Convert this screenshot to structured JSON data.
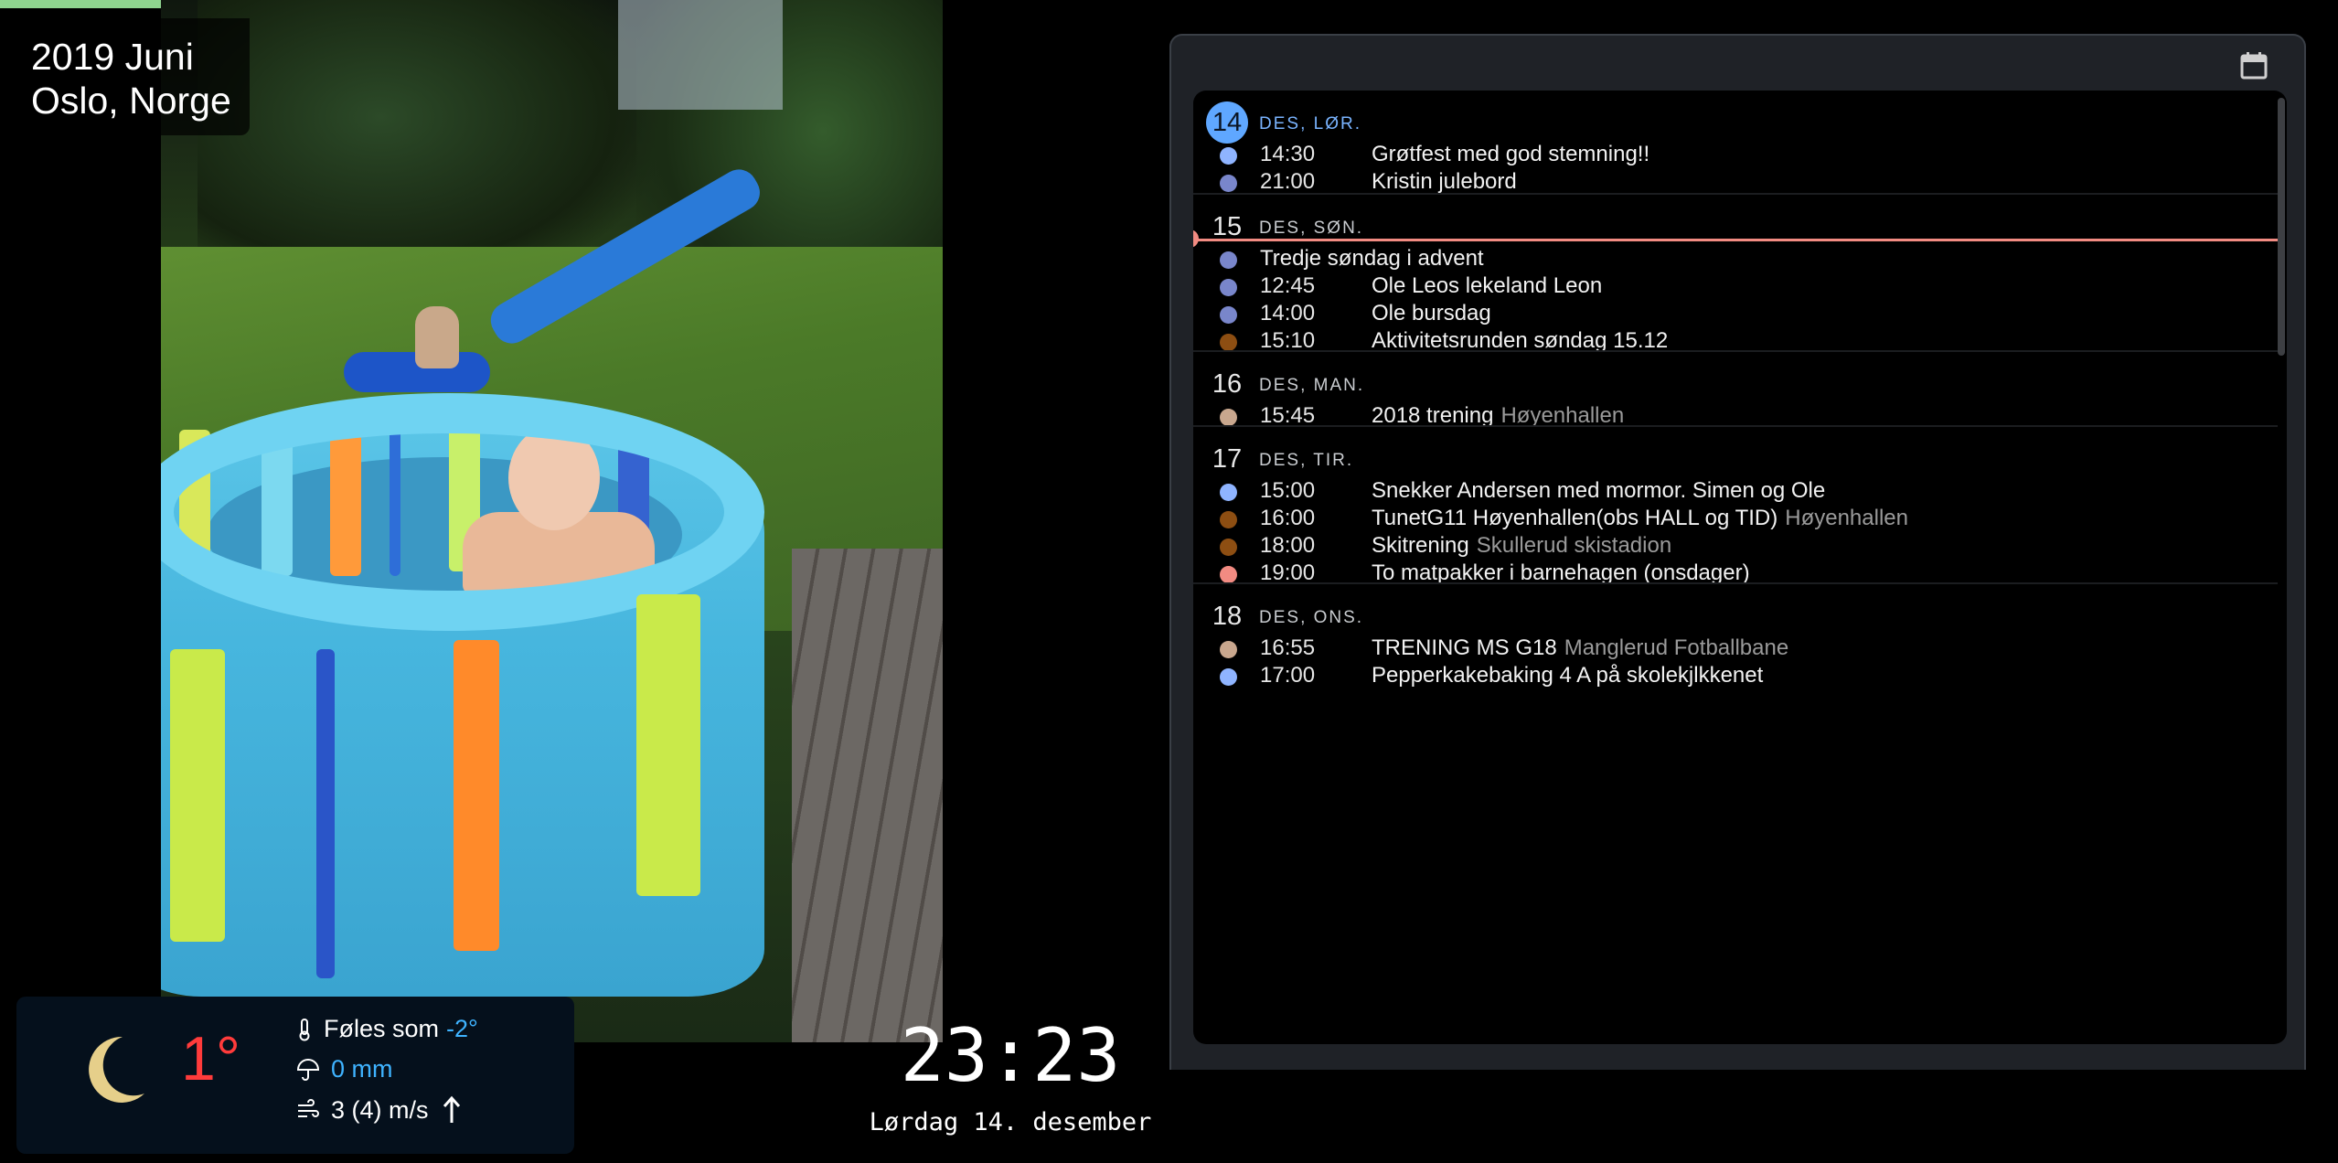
{
  "progress": {
    "fraction": 0.255,
    "color": "#8fd48f"
  },
  "photo": {
    "alt_semantic": "slideshow-photo"
  },
  "location": {
    "line1": "2019 Juni",
    "line2": "Oslo, Norge"
  },
  "weather": {
    "icon": "moon-icon",
    "temperature": "1°",
    "feels_like_label": "Føles som",
    "feels_like_value": "-2°",
    "precipitation": "0 mm",
    "wind": "3 (4) m/s",
    "wind_direction_icon": "arrow-up-icon"
  },
  "clock": {
    "time": "23:23",
    "date": "Lørdag 14. desember"
  },
  "calendar": {
    "header_icon": "calendar-icon",
    "days": [
      {
        "num": "14",
        "label": "DES, LØR.",
        "today": true,
        "events": [
          {
            "time": "14:30",
            "title": "Grøtfest med god stemning!!",
            "location": "",
            "color": "#8fb4ff"
          },
          {
            "time": "21:00",
            "title": "Kristin julebord",
            "location": "",
            "color": "#7986cb"
          }
        ]
      },
      {
        "num": "15",
        "label": "DES, SØN.",
        "today": false,
        "events": [
          {
            "time": "",
            "title": "Tredje søndag i advent",
            "location": "",
            "color": "#7986cb"
          },
          {
            "time": "12:45",
            "title": "Ole Leos lekeland Leon",
            "location": "",
            "color": "#7986cb"
          },
          {
            "time": "14:00",
            "title": "Ole bursdag",
            "location": "",
            "color": "#7986cb"
          },
          {
            "time": "15:10",
            "title": "Aktivitetsrunden søndag 15.12",
            "location": "",
            "color": "#8d4e12"
          }
        ]
      },
      {
        "num": "16",
        "label": "DES, MAN.",
        "today": false,
        "events": [
          {
            "time": "15:45",
            "title": "2018 trening",
            "location": "Høyenhallen",
            "color": "#c9a78e"
          }
        ]
      },
      {
        "num": "17",
        "label": "DES, TIR.",
        "today": false,
        "events": [
          {
            "time": "15:00",
            "title": "Snekker Andersen med mormor. Simen og Ole",
            "location": "",
            "color": "#8fb4ff"
          },
          {
            "time": "16:00",
            "title": "TunetG11 Høyenhallen(obs HALL og TID)",
            "location": "Høyenhallen",
            "color": "#8d4e12"
          },
          {
            "time": "18:00",
            "title": "Skitrening",
            "location": "Skullerud skistadion",
            "color": "#8d4e12"
          },
          {
            "time": "19:00",
            "title": "To matpakker i barnehagen (onsdager)",
            "location": "",
            "color": "#f28b82"
          }
        ]
      },
      {
        "num": "18",
        "label": "DES, ONS.",
        "today": false,
        "events": [
          {
            "time": "16:55",
            "title": "TRENING MS G18",
            "location": "Manglerud Fotballbane",
            "color": "#c9a78e"
          },
          {
            "time": "17:00",
            "title": "Pepperkakebaking 4 A på skolekjlkkenet",
            "location": "",
            "color": "#8fb4ff"
          }
        ]
      }
    ]
  }
}
